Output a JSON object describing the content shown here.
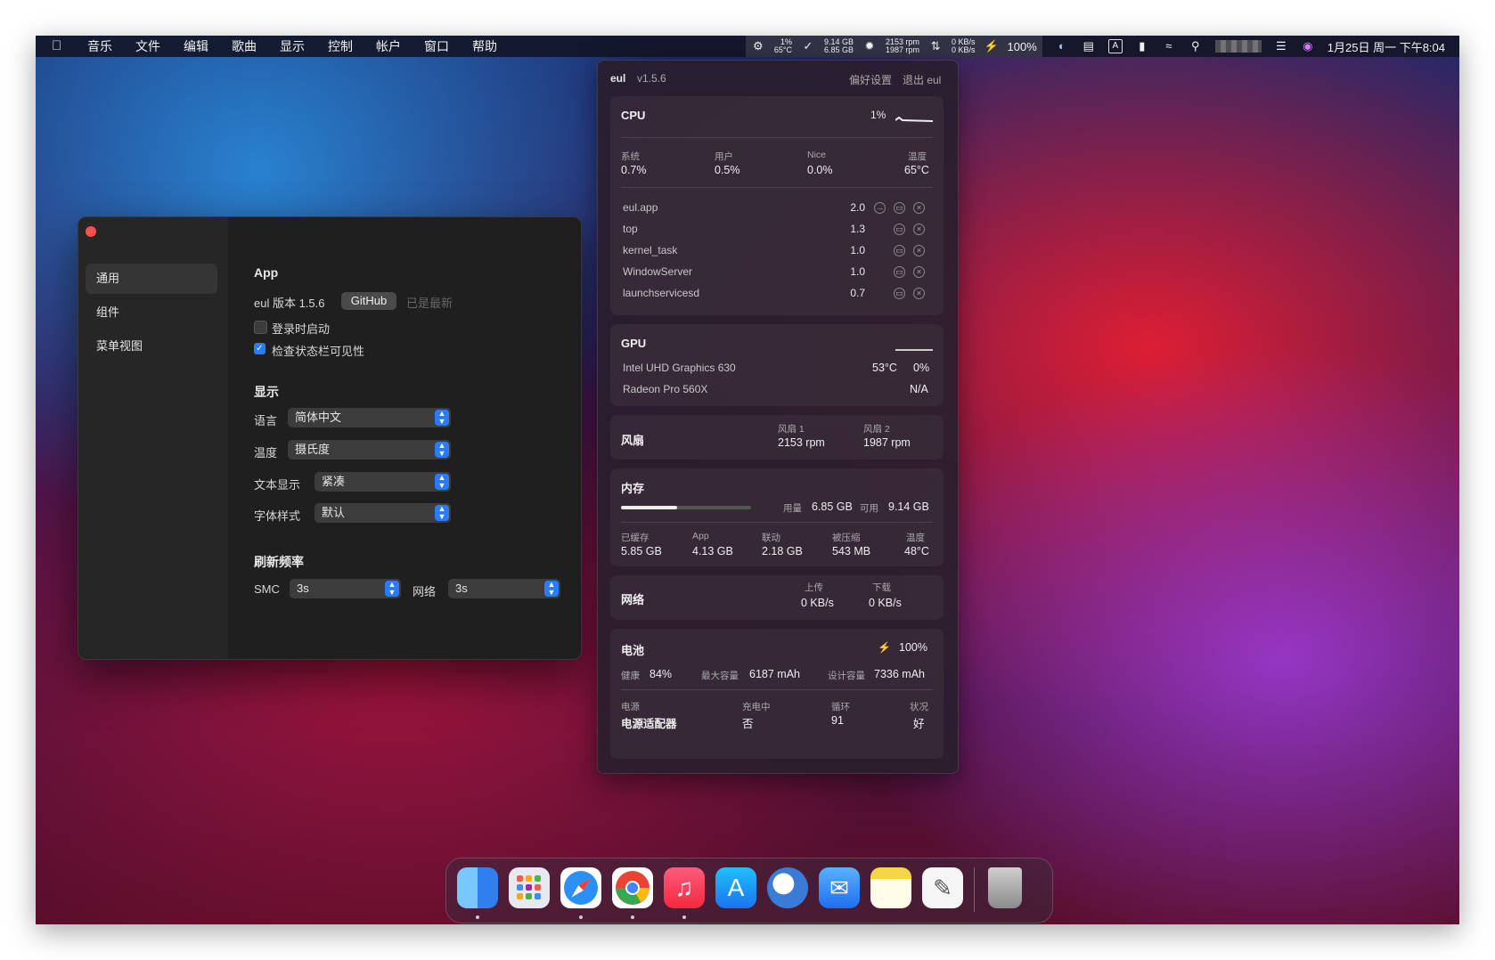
{
  "menubar": {
    "apple": "",
    "items": [
      "音乐",
      "文件",
      "编辑",
      "歌曲",
      "显示",
      "控制",
      "帐户",
      "窗口",
      "帮助"
    ],
    "cpu_pct": "1%",
    "cpu_temp": "65°C",
    "mem_free": "9.14 GB",
    "mem_used": "6.85 GB",
    "fan1": "2153 rpm",
    "fan2": "1987 rpm",
    "net_up": "0 KB/s",
    "net_down": "0 KB/s",
    "battery": "100%",
    "input_method": "A",
    "datetime": "1月25日 周一 下午8:04"
  },
  "settings": {
    "sidebar": [
      "通用",
      "组件",
      "菜单视图"
    ],
    "app_title": "App",
    "version_label": "eul 版本 1.5.6",
    "github_button": "GitHub",
    "up_to_date": "已是最新",
    "launch_at_login": "登录时启动",
    "check_visibility": "检查状态栏可见性",
    "display_title": "显示",
    "language_label": "语言",
    "language_value": "简体中文",
    "temp_label": "温度",
    "temp_value": "摄氏度",
    "text_label": "文本显示",
    "text_value": "紧凑",
    "font_label": "字体样式",
    "font_value": "默认",
    "refresh_title": "刷新频率",
    "smc_label": "SMC",
    "smc_value": "3s",
    "network_label": "网络",
    "network_value": "3s"
  },
  "panel": {
    "app_name": "eul",
    "version": "v1.5.6",
    "preferences": "偏好设置",
    "quit": "退出 eul",
    "cpu": {
      "title": "CPU",
      "usage": "1%",
      "labels": [
        "系统",
        "用户",
        "Nice",
        "温度"
      ],
      "values": [
        "0.7%",
        "0.5%",
        "0.0%",
        "65°C"
      ],
      "processes": [
        {
          "name": "eul.app",
          "value": "2.0"
        },
        {
          "name": "top",
          "value": "1.3"
        },
        {
          "name": "kernel_task",
          "value": "1.0"
        },
        {
          "name": "WindowServer",
          "value": "1.0"
        },
        {
          "name": "launchservicesd",
          "value": "0.7"
        }
      ]
    },
    "gpu": {
      "title": "GPU",
      "gpu1_name": "Intel UHD Graphics 630",
      "gpu1_temp": "53°C",
      "gpu1_usage": "0%",
      "gpu2_name": "Radeon Pro 560X",
      "gpu2_value": "N/A"
    },
    "fan": {
      "title": "风扇",
      "fan1_label": "风扇 1",
      "fan1_value": "2153 rpm",
      "fan2_label": "风扇 2",
      "fan2_value": "1987 rpm"
    },
    "memory": {
      "title": "内存",
      "used_label": "用量",
      "used_value": "6.85 GB",
      "free_label": "可用",
      "free_value": "9.14 GB",
      "used_fraction": 0.43,
      "labels": [
        "已缓存",
        "App",
        "联动",
        "被压缩",
        "温度"
      ],
      "values": [
        "5.85 GB",
        "4.13 GB",
        "2.18 GB",
        "543 MB",
        "48°C"
      ]
    },
    "network": {
      "title": "网络",
      "up_label": "上传",
      "up_value": "0 KB/s",
      "down_label": "下载",
      "down_value": "0 KB/s"
    },
    "battery": {
      "title": "电池",
      "level": "100%",
      "health_label": "健康",
      "health_value": "84%",
      "max_label": "最大容量",
      "max_value": "6187 mAh",
      "design_label": "设计容量",
      "design_value": "7336 mAh",
      "labels": [
        "电源",
        "充电中",
        "循环",
        "状况"
      ],
      "values": [
        "电源适配器",
        "否",
        "91",
        "好"
      ]
    }
  },
  "dock": {
    "apps": [
      "finder-icon",
      "launchpad-icon",
      "safari-icon",
      "chrome-icon",
      "music-icon",
      "app-store-icon",
      "eul-icon",
      "mail-icon",
      "notes-icon",
      "textedit-icon",
      "trash-icon"
    ],
    "colors": {
      "finder": "#3d8ef0",
      "safari": "#2a90f5",
      "music": "#fa3655",
      "appstore": "#1b8cf7",
      "mail": "#3b9af5",
      "notes": "#f7d44a"
    }
  }
}
